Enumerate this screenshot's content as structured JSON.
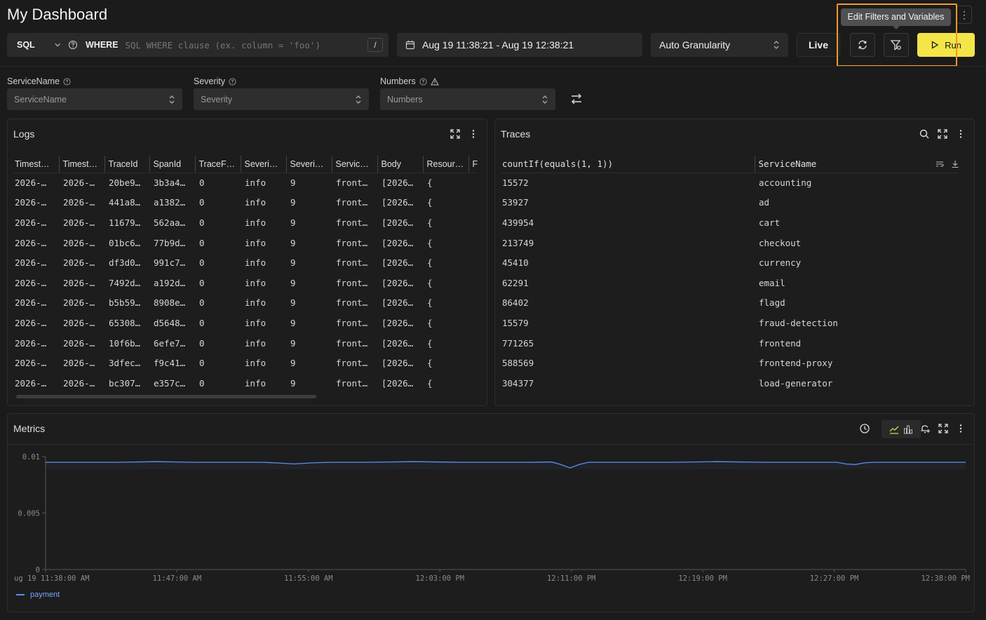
{
  "header": {
    "title": "My Dashboard",
    "more_label": "⋮"
  },
  "query": {
    "language": "SQL",
    "where_label": "WHERE",
    "where_placeholder": "SQL WHERE clause (ex. column = 'foo')",
    "shortcut": "/"
  },
  "time_range": "Aug 19 11:38:21 - Aug 19 12:38:21",
  "granularity": "Auto Granularity",
  "live_label": "Live",
  "run_label": "Run",
  "tooltip": "Edit Filters and Variables",
  "accent_color": "#f4e549",
  "highlight_color": "#f39a2c",
  "filters": [
    {
      "label": "ServiceName",
      "placeholder": "ServiceName",
      "warn": false
    },
    {
      "label": "Severity",
      "placeholder": "Severity",
      "warn": false
    },
    {
      "label": "Numbers",
      "placeholder": "Numbers",
      "warn": true
    }
  ],
  "logs": {
    "title": "Logs",
    "columns": [
      "Timest…",
      "Timest…",
      "TraceId",
      "SpanId",
      "TraceF…",
      "Severi…",
      "Severi…",
      "Servic…",
      "Body",
      "Resour…",
      "F"
    ],
    "rows": [
      [
        "2026-…",
        "2026-…",
        "20be9…",
        "3b3a4…",
        "0",
        "info",
        "9",
        "front…",
        "[2026…",
        "{"
      ],
      [
        "2026-…",
        "2026-…",
        "441a8…",
        "a1382…",
        "0",
        "info",
        "9",
        "front…",
        "[2026…",
        "{"
      ],
      [
        "2026-…",
        "2026-…",
        "11679…",
        "562aa…",
        "0",
        "info",
        "9",
        "front…",
        "[2026…",
        "{"
      ],
      [
        "2026-…",
        "2026-…",
        "01bc6…",
        "77b9d…",
        "0",
        "info",
        "9",
        "front…",
        "[2026…",
        "{"
      ],
      [
        "2026-…",
        "2026-…",
        "df3d0…",
        "991c7…",
        "0",
        "info",
        "9",
        "front…",
        "[2026…",
        "{"
      ],
      [
        "2026-…",
        "2026-…",
        "7492d…",
        "a192d…",
        "0",
        "info",
        "9",
        "front…",
        "[2026…",
        "{"
      ],
      [
        "2026-…",
        "2026-…",
        "b5b59…",
        "8908e…",
        "0",
        "info",
        "9",
        "front…",
        "[2026…",
        "{"
      ],
      [
        "2026-…",
        "2026-…",
        "65308…",
        "d5648…",
        "0",
        "info",
        "9",
        "front…",
        "[2026…",
        "{"
      ],
      [
        "2026-…",
        "2026-…",
        "10f6b…",
        "6efe7…",
        "0",
        "info",
        "9",
        "front…",
        "[2026…",
        "{"
      ],
      [
        "2026-…",
        "2026-…",
        "3dfec…",
        "f9c41…",
        "0",
        "info",
        "9",
        "front…",
        "[2026…",
        "{"
      ],
      [
        "2026-…",
        "2026-…",
        "bc307…",
        "e357c…",
        "0",
        "info",
        "9",
        "front…",
        "[2026…",
        "{"
      ]
    ]
  },
  "traces": {
    "title": "Traces",
    "columns": [
      "countIf(equals(1, 1))",
      "ServiceName"
    ],
    "rows": [
      [
        "15572",
        "accounting"
      ],
      [
        "53927",
        "ad"
      ],
      [
        "439954",
        "cart"
      ],
      [
        "213749",
        "checkout"
      ],
      [
        "45410",
        "currency"
      ],
      [
        "62291",
        "email"
      ],
      [
        "86402",
        "flagd"
      ],
      [
        "15579",
        "fraud-detection"
      ],
      [
        "771265",
        "frontend"
      ],
      [
        "588569",
        "frontend-proxy"
      ],
      [
        "304377",
        "load-generator"
      ]
    ]
  },
  "metrics": {
    "title": "Metrics",
    "series_color": "#5b8ef0",
    "legend_color": "#7aa2ff"
  },
  "chart_data": {
    "type": "line",
    "x": [
      "ug 19 11:38:00 AM",
      "11:47:00 AM",
      "11:55:00 AM",
      "12:03:00 PM",
      "12:11:00 PM",
      "12:19:00 PM",
      "12:27:00 PM",
      "12:38:00 PM"
    ],
    "series": [
      {
        "name": "payment",
        "points": [
          [
            0,
            0.0095
          ],
          [
            0.04,
            0.0095
          ],
          [
            0.08,
            0.0095
          ],
          [
            0.12,
            0.00955
          ],
          [
            0.16,
            0.0095
          ],
          [
            0.2,
            0.0095
          ],
          [
            0.235,
            0.0095
          ],
          [
            0.25,
            0.00945
          ],
          [
            0.27,
            0.00935
          ],
          [
            0.29,
            0.00945
          ],
          [
            0.31,
            0.0095
          ],
          [
            0.35,
            0.0095
          ],
          [
            0.4,
            0.00955
          ],
          [
            0.45,
            0.0095
          ],
          [
            0.5,
            0.0095
          ],
          [
            0.53,
            0.0095
          ],
          [
            0.55,
            0.00952
          ],
          [
            0.56,
            0.0093
          ],
          [
            0.57,
            0.009
          ],
          [
            0.58,
            0.0093
          ],
          [
            0.59,
            0.0095
          ],
          [
            0.63,
            0.0095
          ],
          [
            0.68,
            0.0095
          ],
          [
            0.73,
            0.00955
          ],
          [
            0.78,
            0.0095
          ],
          [
            0.84,
            0.0095
          ],
          [
            0.86,
            0.0095
          ],
          [
            0.87,
            0.00935
          ],
          [
            0.88,
            0.0093
          ],
          [
            0.89,
            0.00945
          ],
          [
            0.9,
            0.0095
          ],
          [
            0.95,
            0.0095
          ],
          [
            1,
            0.0095
          ]
        ]
      }
    ],
    "yticks": [
      "0.01",
      "0.005",
      "0"
    ],
    "ylim": [
      0,
      0.01
    ],
    "legend": "bottom-left"
  }
}
